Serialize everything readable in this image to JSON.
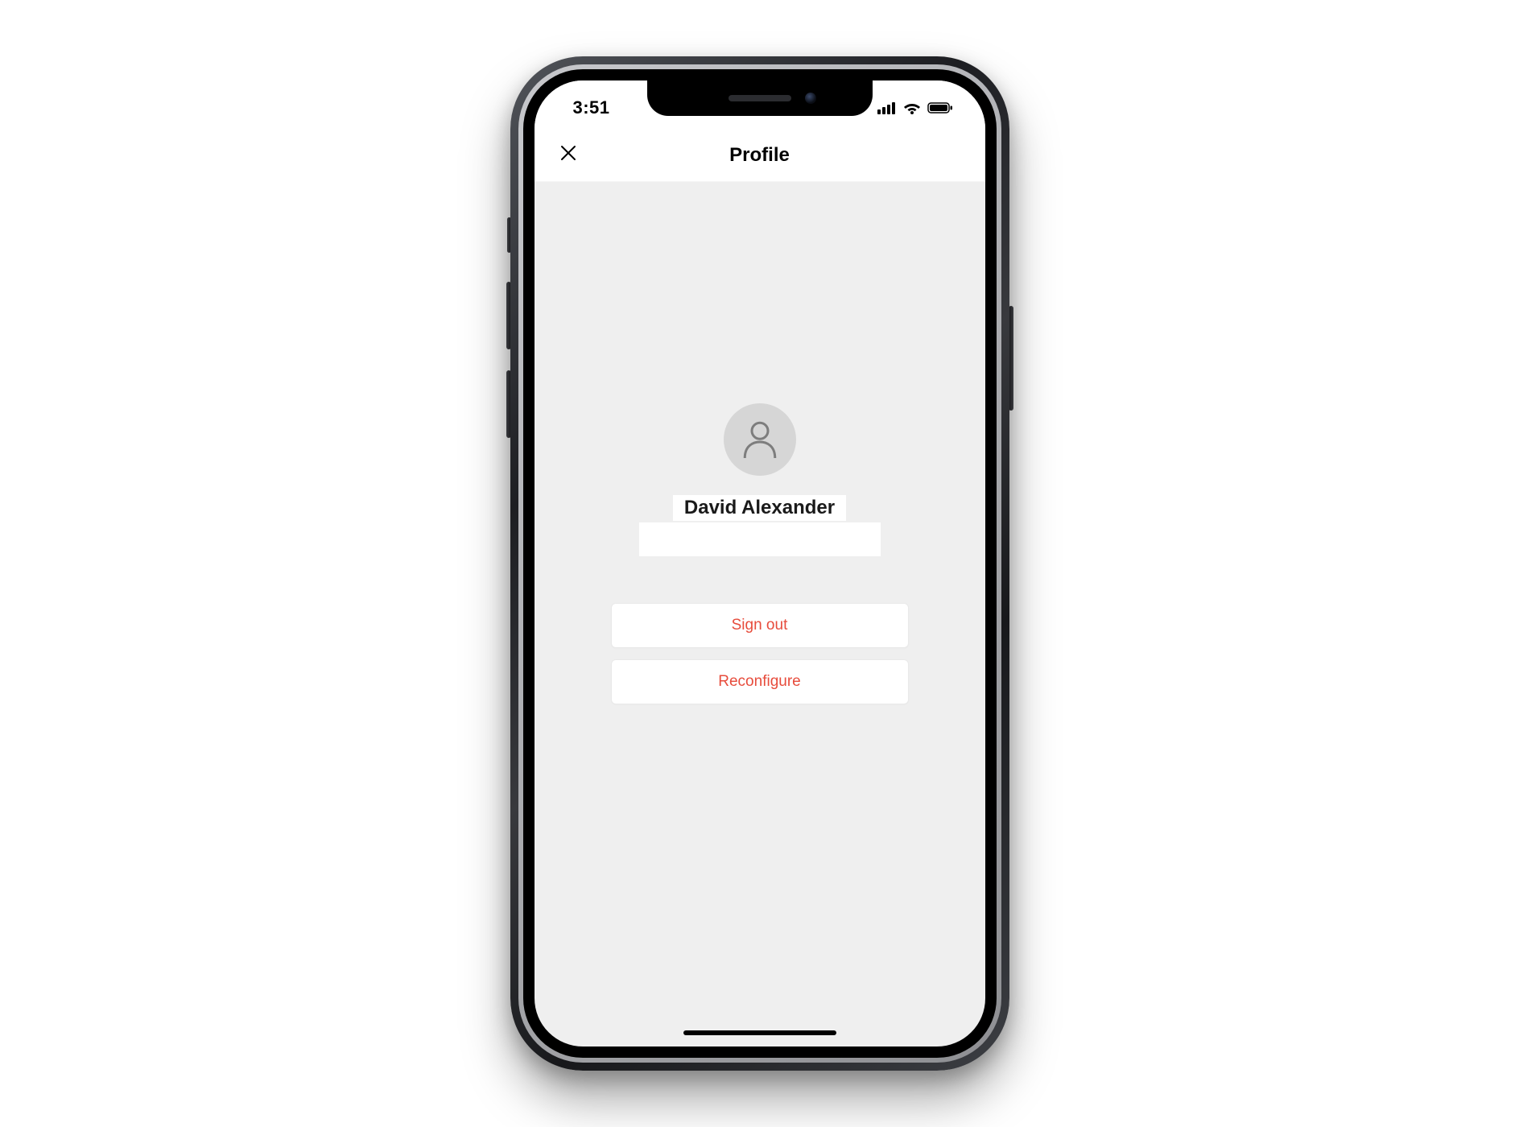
{
  "statusbar": {
    "time": "3:51"
  },
  "nav": {
    "title": "Profile"
  },
  "profile": {
    "username": "David Alexander"
  },
  "actions": {
    "signout_label": "Sign out",
    "reconfigure_label": "Reconfigure"
  },
  "colors": {
    "danger": "#e74c3c",
    "content_bg": "#efefef"
  }
}
